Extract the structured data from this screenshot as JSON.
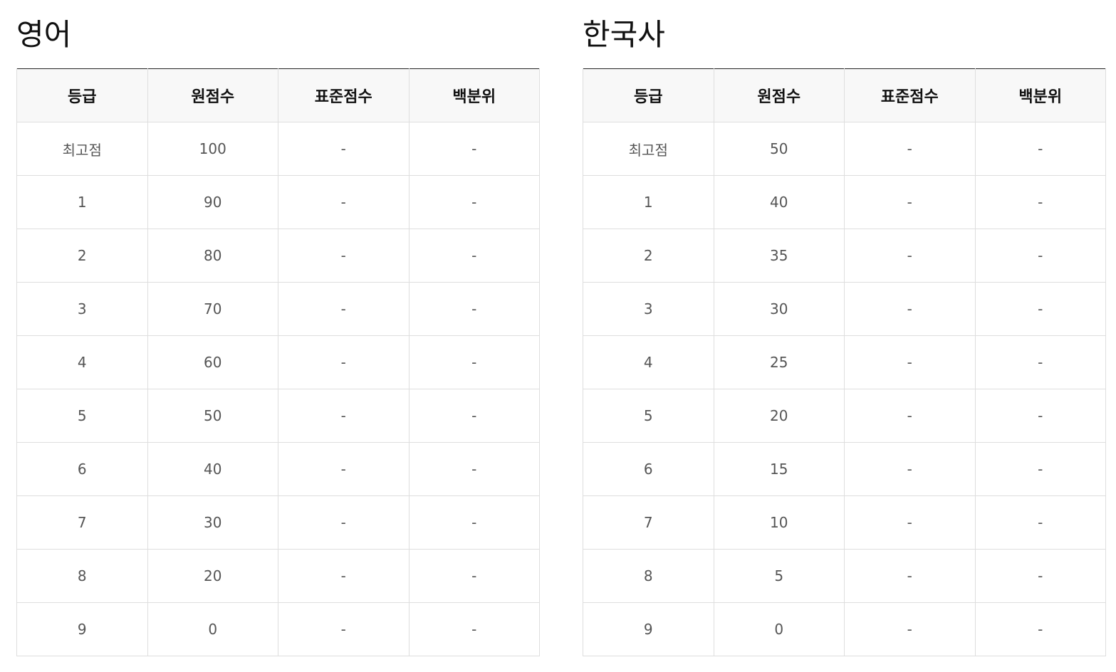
{
  "headers": [
    "등급",
    "원점수",
    "표준점수",
    "백분위"
  ],
  "tables": [
    {
      "title": "영어",
      "rows": [
        {
          "grade": "최고점",
          "raw": "100",
          "std": "-",
          "pct": "-"
        },
        {
          "grade": "1",
          "raw": "90",
          "std": "-",
          "pct": "-"
        },
        {
          "grade": "2",
          "raw": "80",
          "std": "-",
          "pct": "-"
        },
        {
          "grade": "3",
          "raw": "70",
          "std": "-",
          "pct": "-"
        },
        {
          "grade": "4",
          "raw": "60",
          "std": "-",
          "pct": "-"
        },
        {
          "grade": "5",
          "raw": "50",
          "std": "-",
          "pct": "-"
        },
        {
          "grade": "6",
          "raw": "40",
          "std": "-",
          "pct": "-"
        },
        {
          "grade": "7",
          "raw": "30",
          "std": "-",
          "pct": "-"
        },
        {
          "grade": "8",
          "raw": "20",
          "std": "-",
          "pct": "-"
        },
        {
          "grade": "9",
          "raw": "0",
          "std": "-",
          "pct": "-"
        }
      ]
    },
    {
      "title": "한국사",
      "rows": [
        {
          "grade": "최고점",
          "raw": "50",
          "std": "-",
          "pct": "-"
        },
        {
          "grade": "1",
          "raw": "40",
          "std": "-",
          "pct": "-"
        },
        {
          "grade": "2",
          "raw": "35",
          "std": "-",
          "pct": "-"
        },
        {
          "grade": "3",
          "raw": "30",
          "std": "-",
          "pct": "-"
        },
        {
          "grade": "4",
          "raw": "25",
          "std": "-",
          "pct": "-"
        },
        {
          "grade": "5",
          "raw": "20",
          "std": "-",
          "pct": "-"
        },
        {
          "grade": "6",
          "raw": "15",
          "std": "-",
          "pct": "-"
        },
        {
          "grade": "7",
          "raw": "10",
          "std": "-",
          "pct": "-"
        },
        {
          "grade": "8",
          "raw": "5",
          "std": "-",
          "pct": "-"
        },
        {
          "grade": "9",
          "raw": "0",
          "std": "-",
          "pct": "-"
        }
      ]
    }
  ],
  "colors": {
    "raw_score_text": "#5b7fc7",
    "standard_score_text": "#8fa6d6",
    "header_background": "#f8f8f8",
    "cell_border": "#dedede",
    "table_top_border": "#222222"
  }
}
